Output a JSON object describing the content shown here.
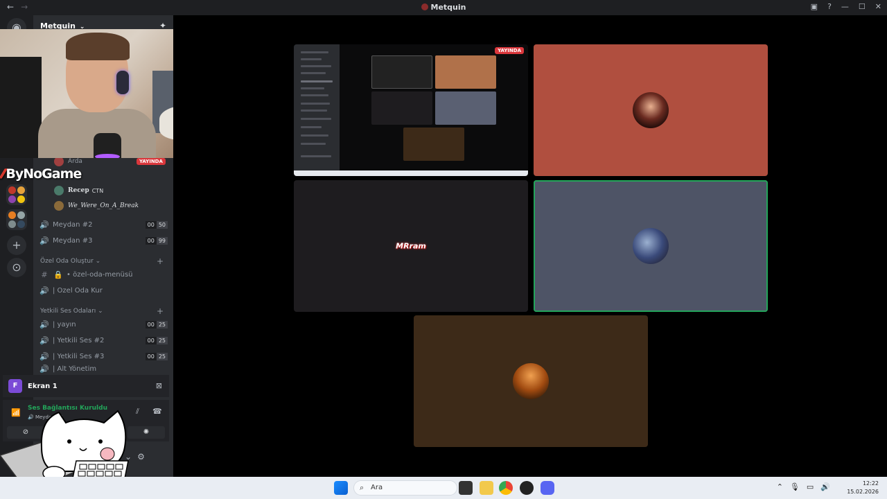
{
  "window": {
    "title": "Metquin",
    "nav_back": "←",
    "nav_forward": "→",
    "minimize": "—",
    "maximize": "☐",
    "close": "✕",
    "inbox_icon": "inbox-icon",
    "help_icon": "help-icon"
  },
  "server": {
    "name": "Metquin",
    "chevron": "⌄"
  },
  "overlay": {
    "bynogame": "ByNoGame",
    "live_badge": "YAYINDA"
  },
  "members": [
    {
      "name": "Arda",
      "tag": ""
    },
    {
      "name": "Recep",
      "tag": "CTN"
    },
    {
      "name": "We_Were_On_A_Break",
      "tag": ""
    }
  ],
  "channels": {
    "meydan2": {
      "label": "Meydan #2",
      "count_a": "00",
      "count_b": "50"
    },
    "meydan3": {
      "label": "Meydan #3",
      "count_a": "00",
      "count_b": "99"
    },
    "cat_ozel": "Özel Oda Oluştur",
    "ozel_menu": "• özel-oda-menüsü",
    "ozel_kur": "| Özel Oda Kur",
    "cat_yetkili": "Yetkili Ses Odaları",
    "yayin": {
      "label": "| yayın",
      "count_a": "00",
      "count_b": "25"
    },
    "yetkili2": {
      "label": "| Yetkili Ses #2",
      "count_a": "00",
      "count_b": "25"
    },
    "yetkili3": {
      "label": "| Yetkili Ses #3",
      "count_a": "00",
      "count_b": "25"
    },
    "alt_yonetim": "| Alt Yönetim"
  },
  "screen_share": {
    "label": "Ekran 1",
    "badge": "F"
  },
  "voice": {
    "status": "Ses Bağlantısı Kuruldu",
    "channel": "Meydan #1"
  },
  "taskbar": {
    "search_placeholder": "Ara",
    "time": "12:22",
    "date": "15.02.2026"
  },
  "colors": {
    "tile_orange": "#b04f3f",
    "tile_dark": "#1e1c1f",
    "tile_slate": "#4e5466",
    "tile_brown": "#3d2a18",
    "speaking": "#23a55a",
    "live": "#da373c"
  }
}
